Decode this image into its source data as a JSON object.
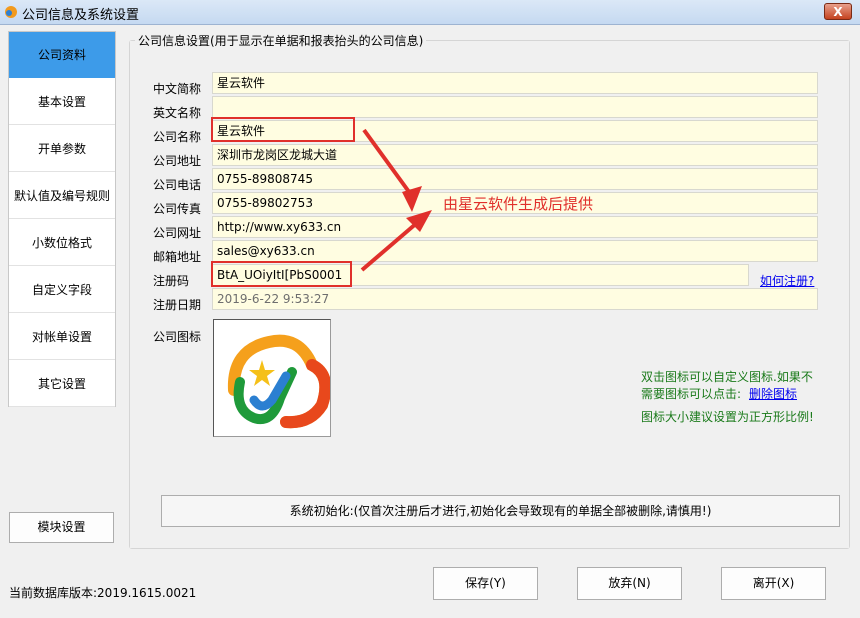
{
  "window": {
    "title": "公司信息及系统设置",
    "close_label": "X"
  },
  "sidebar": {
    "items": [
      {
        "label": "公司资料",
        "active": true
      },
      {
        "label": "基本设置"
      },
      {
        "label": "开单参数"
      },
      {
        "label": "默认值及编号规则"
      },
      {
        "label": "小数位格式"
      },
      {
        "label": "自定义字段"
      },
      {
        "label": "对帐单设置"
      },
      {
        "label": "其它设置"
      }
    ],
    "module_button": "模块设置"
  },
  "company": {
    "group_title": "公司信息设置(用于显示在单据和报表抬头的公司信息)",
    "fields": [
      {
        "label": "中文简称",
        "value": "星云软件"
      },
      {
        "label": "英文名称",
        "value": ""
      },
      {
        "label": "公司名称",
        "value": "星云软件"
      },
      {
        "label": "公司地址",
        "value": "深圳市龙岗区龙城大道"
      },
      {
        "label": "公司电话",
        "value": "0755-89808745"
      },
      {
        "label": "公司传真",
        "value": "0755-89802753"
      },
      {
        "label": "公司网址",
        "value": "http://www.xy633.cn"
      },
      {
        "label": "邮箱地址",
        "value": "sales@xy633.cn"
      },
      {
        "label": "注册码",
        "value": "BtA_UOiyItI[PbS0001"
      },
      {
        "label": "注册日期",
        "value": "2019-6-22 9:53:27"
      }
    ],
    "register_link": "如何注册?",
    "annotation": "由星云软件生成后提供",
    "logo_label": "公司图标",
    "logo_hint_line1": "双击图标可以自定义图标.如果不",
    "logo_hint_line2": "需要图标可以点击:",
    "delete_logo_link": "删除图标",
    "logo_hint_line3": "图标大小建议设置为正方形比例!"
  },
  "init_button": "系统初始化:(仅首次注册后才进行,初始化会导致现有的单据全部被删除,请慎用!)",
  "footer": {
    "db_version": "当前数据库版本:2019.1615.0021",
    "save": "保存(Y)",
    "cancel": "放弃(N)",
    "exit": "离开(X)"
  },
  "colors": {
    "accent": "#3d9be9",
    "field_bg": "#fffde1",
    "annotation": "#e0302b",
    "hint": "#1a7a1a"
  }
}
